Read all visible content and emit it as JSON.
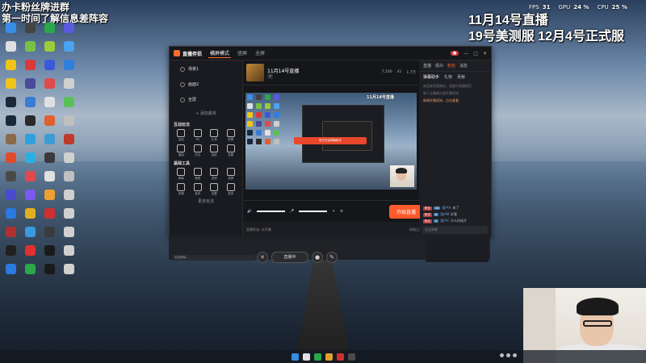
{
  "overlay": {
    "top_left_line1": "办卡粉丝牌进群",
    "top_left_line2": "第一时间了解信息差阵容",
    "top_right_line1": "11月14号直播",
    "top_right_line2": "19号美测服 12月4号正式服"
  },
  "perf": {
    "fps_label": "FPS",
    "fps_value": "31",
    "gpu_label": "GPU",
    "gpu_value": "24 %",
    "cpu_label": "CPU",
    "cpu_value": "25 %"
  },
  "desktop_icons": [
    {
      "color": "#3b8ee8"
    },
    {
      "color": "#444"
    },
    {
      "color": "#2ba84a"
    },
    {
      "color": "#5a5ae0"
    },
    {
      "color": "#e0e0e0"
    },
    {
      "color": "#77c144"
    },
    {
      "color": "#9bcc3a"
    },
    {
      "color": "#4aa3f0"
    },
    {
      "color": "#f0c419"
    },
    {
      "color": "#d93a3a"
    },
    {
      "color": "#3a5bd9"
    },
    {
      "color": "#2f7fe0"
    },
    {
      "color": "#f0c419"
    },
    {
      "color": "#4a4a9a"
    },
    {
      "color": "#e04a4a"
    },
    {
      "color": "#d0d0d0"
    },
    {
      "color": "#1b2838"
    },
    {
      "color": "#3a7bd5"
    },
    {
      "color": "#e0e0e0"
    },
    {
      "color": "#5ac05a"
    },
    {
      "color": "#1b2838"
    },
    {
      "color": "#2a2a2a"
    },
    {
      "color": "#e06030"
    },
    {
      "color": "#c0c0c0"
    },
    {
      "color": "#8a6a4a"
    },
    {
      "color": "#2ea0e0"
    },
    {
      "color": "#3a9bd5"
    },
    {
      "color": "#c0392b"
    },
    {
      "color": "#e04a2a"
    },
    {
      "color": "#2ab0e0"
    },
    {
      "color": "#3a3a3a"
    },
    {
      "color": "#d0d0d0"
    },
    {
      "color": "#4a4a4a"
    },
    {
      "color": "#e04a4a"
    },
    {
      "color": "#e0e0e0"
    },
    {
      "color": "#c0c0c0"
    },
    {
      "color": "#4a4ad0"
    },
    {
      "color": "#7a5af0"
    },
    {
      "color": "#f0a030"
    },
    {
      "color": "#d0d0d0"
    },
    {
      "color": "#2a7ae0"
    },
    {
      "color": "#e0b020"
    },
    {
      "color": "#d03030"
    },
    {
      "color": "#d0d0d0"
    },
    {
      "color": "#b03030"
    },
    {
      "color": "#3a9ae0"
    },
    {
      "color": "#3a3a3a"
    },
    {
      "color": "#d0d0d0"
    },
    {
      "color": "#202020"
    },
    {
      "color": "#e03030"
    },
    {
      "color": "#1a1a1a"
    },
    {
      "color": "#d0d0d0"
    },
    {
      "color": "#2a7ae0"
    },
    {
      "color": "#2aa84a"
    },
    {
      "color": "#1a1a1a"
    },
    {
      "color": "#d0d0d0"
    }
  ],
  "window": {
    "app_name": "直播伴侣",
    "tabs": [
      "横屏模式",
      "竖屏",
      "全屏"
    ],
    "left_items": [
      "场景1",
      "画面2",
      "全屏"
    ],
    "add_label": "+ 添加素材",
    "interaction_title": "互动玩法",
    "interaction_tools": [
      "连线",
      "PK",
      "礼物",
      "投票",
      "福袋",
      "红包",
      "抽奖",
      "答题"
    ],
    "basic_tools_title": "基础工具",
    "basic_tools": [
      "弹幕",
      "美颜",
      "滤镜",
      "录屏",
      "剪辑",
      "音效",
      "设置",
      "更多"
    ],
    "more_label": "更多玩法",
    "stream_title": "11月14号直播",
    "live_button": "开始直播",
    "warn_text": "您已开启弹幕助手",
    "stats": [
      "7,160",
      "41",
      "1.7万"
    ],
    "status_left": "直播状态: 未开播",
    "status_right": "网络正常",
    "pill_label": "直播中",
    "right_tabs": [
      "直播",
      "观众",
      "粉丝",
      "消息"
    ],
    "right_subtabs": [
      "弹幕助手",
      "礼物",
      "贡献"
    ],
    "right_msgs": [
      "欢迎来到直播间，请遵守直播规范",
      "新人主播请注意开播须知"
    ],
    "right_highlight": "新增开播须知，点击查看",
    "chat": [
      {
        "lv": "粉丝",
        "lv2": "12",
        "name": "用户A",
        "msg": "来了"
      },
      {
        "lv": "粉丝",
        "lv2": "8",
        "name": "用户B",
        "msg": "好看"
      },
      {
        "lv": "粉丝",
        "lv2": "5",
        "name": "用户C",
        "msg": "什么时候开"
      }
    ],
    "chat_placeholder": "发送弹幕",
    "danmu_placeholder": "发送弹幕..."
  },
  "taskbar_icons": [
    {
      "color": "#3a8ae0"
    },
    {
      "color": "#e0e0e0"
    },
    {
      "color": "#2aa84a"
    },
    {
      "color": "#e0a030"
    },
    {
      "color": "#d03030"
    },
    {
      "color": "#4a4a4a"
    }
  ]
}
